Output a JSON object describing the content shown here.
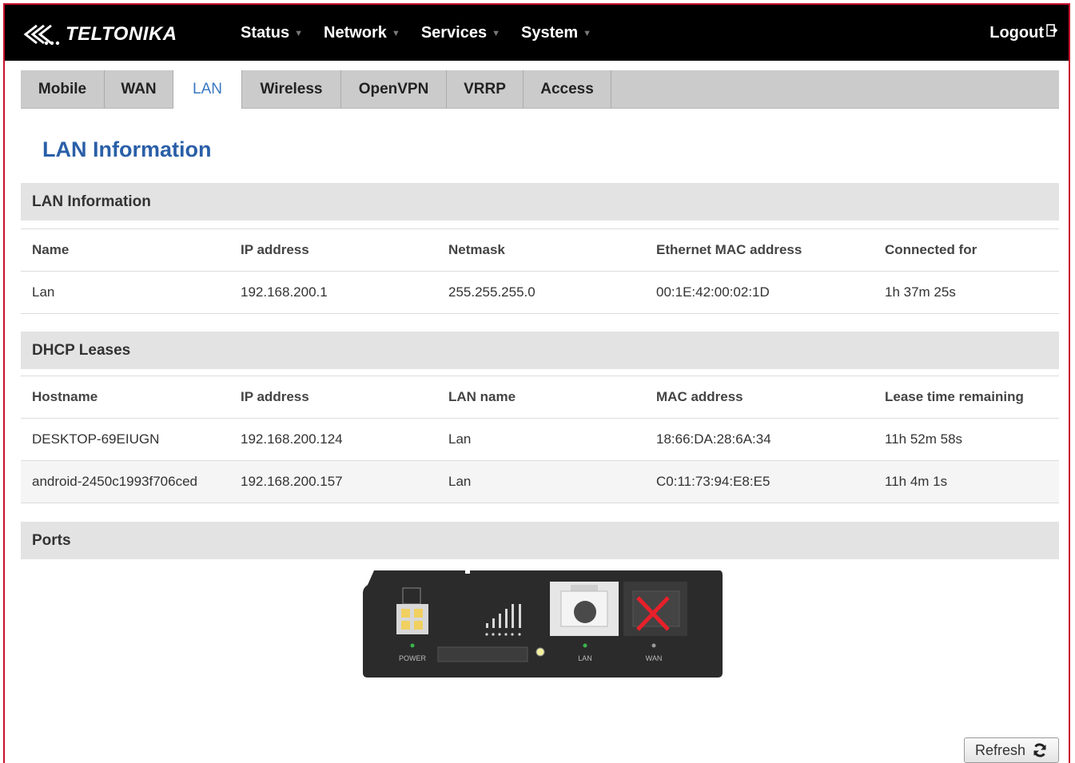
{
  "brand": {
    "name": "TELTONIKA"
  },
  "nav": {
    "menu": [
      {
        "label": "Status"
      },
      {
        "label": "Network"
      },
      {
        "label": "Services"
      },
      {
        "label": "System"
      }
    ],
    "logout_label": "Logout"
  },
  "tabs": [
    {
      "label": "Mobile"
    },
    {
      "label": "WAN"
    },
    {
      "label": "LAN",
      "active": true
    },
    {
      "label": "Wireless"
    },
    {
      "label": "OpenVPN"
    },
    {
      "label": "VRRP"
    },
    {
      "label": "Access"
    }
  ],
  "page_title": "LAN Information",
  "lan_info": {
    "title": "LAN Information",
    "columns": [
      "Name",
      "IP address",
      "Netmask",
      "Ethernet MAC address",
      "Connected for"
    ],
    "rows": [
      [
        "Lan",
        "192.168.200.1",
        "255.255.255.0",
        "00:1E:42:00:02:1D",
        "1h 37m 25s"
      ]
    ]
  },
  "dhcp": {
    "title": "DHCP Leases",
    "columns": [
      "Hostname",
      "IP address",
      "LAN name",
      "MAC address",
      "Lease time remaining"
    ],
    "rows": [
      [
        "DESKTOP-69EIUGN",
        "192.168.200.124",
        "Lan",
        "18:66:DA:28:6A:34",
        "11h 52m 58s"
      ],
      [
        "android-2450c1993f706ced",
        "192.168.200.157",
        "Lan",
        "C0:11:73:94:E8:E5",
        "11h 4m 1s"
      ]
    ]
  },
  "ports": {
    "title": "Ports",
    "labels": {
      "power": "POWER",
      "lan": "LAN",
      "wan": "WAN"
    },
    "lan_connected": true,
    "wan_connected": false
  },
  "refresh_label": "Refresh",
  "colors": {
    "frame": "#c8102e",
    "accent": "#2a5fa8",
    "tab_active": "#3a78c2",
    "led_green": "#39b54a",
    "wan_x": "#e8202a"
  }
}
